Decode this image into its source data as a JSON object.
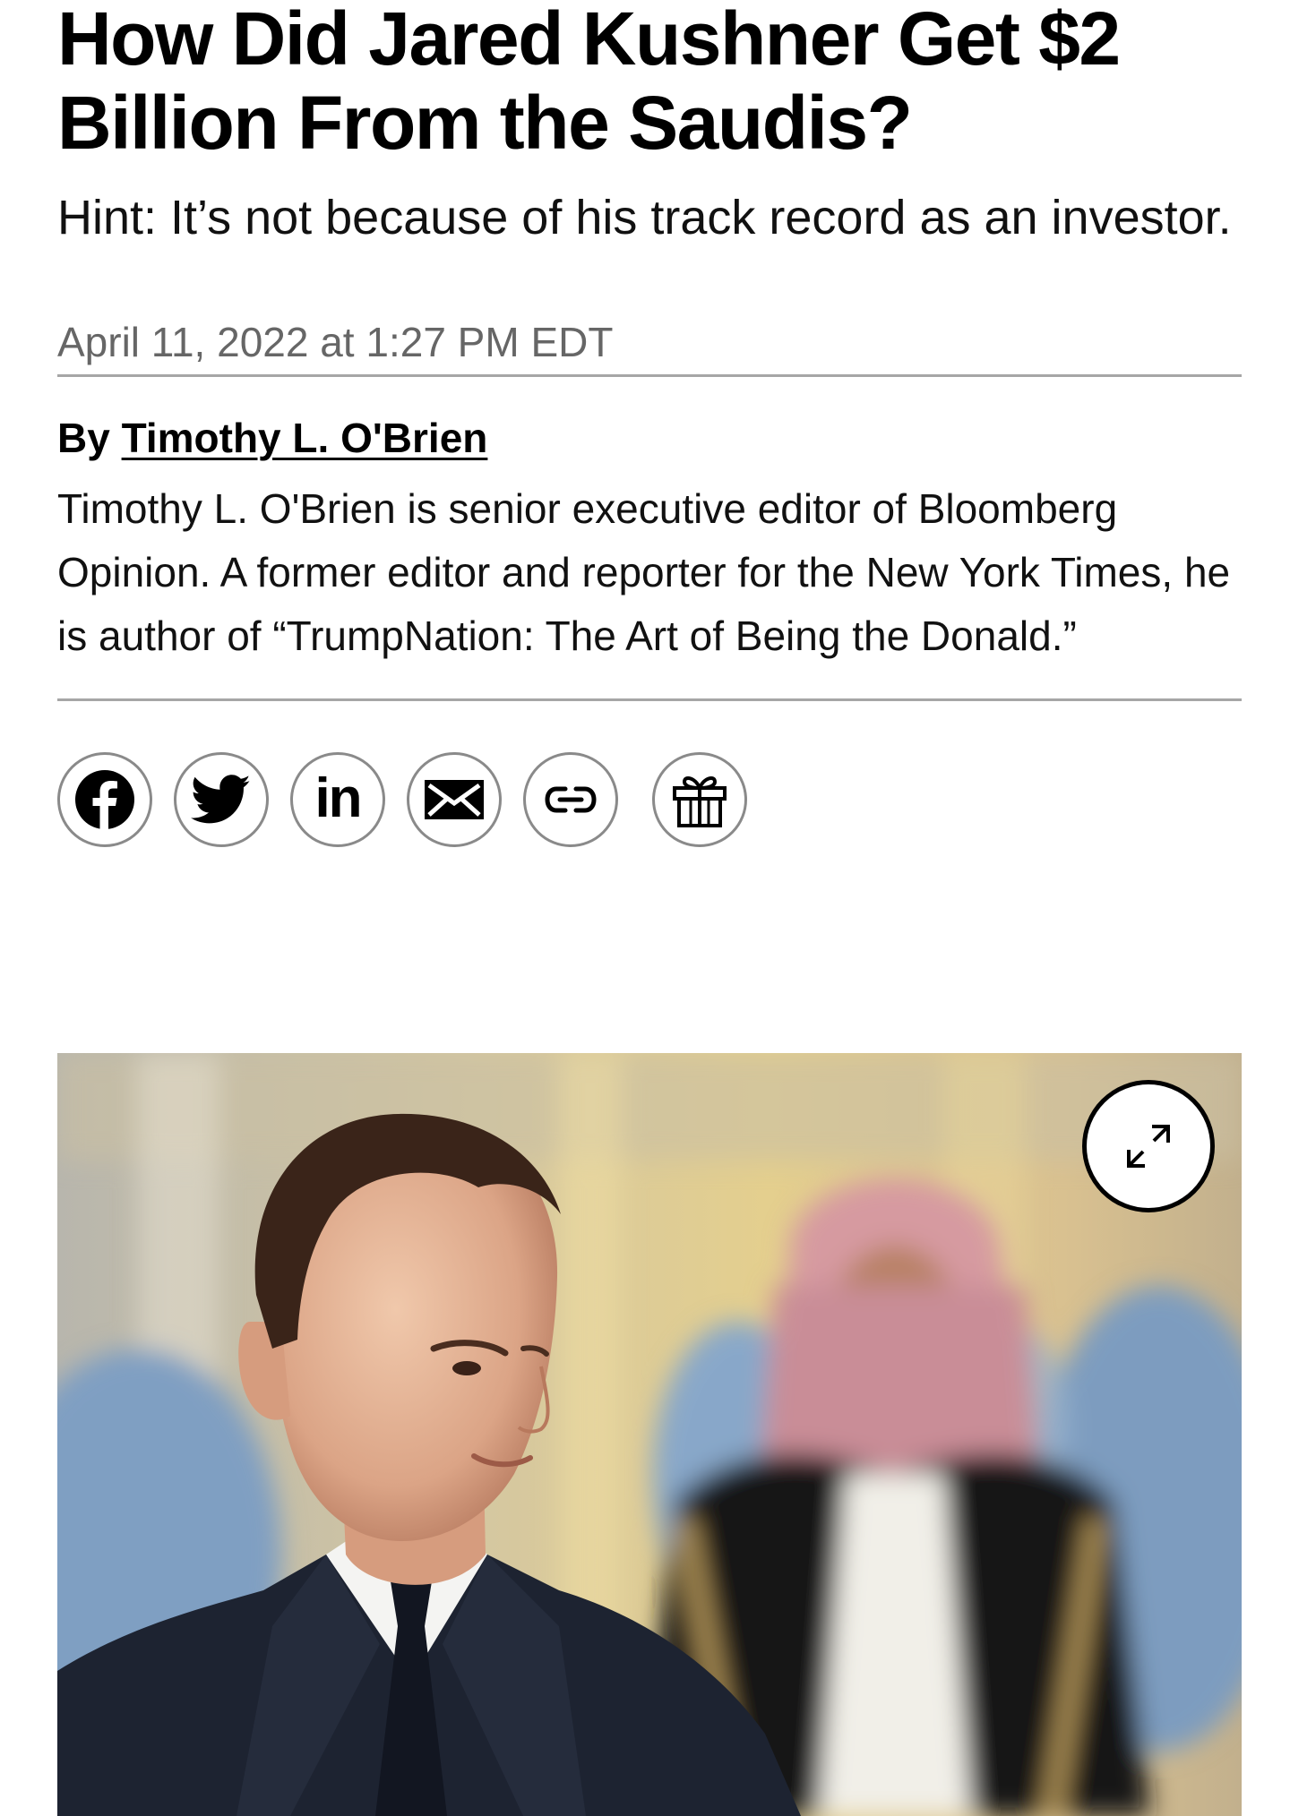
{
  "article": {
    "headline": "How Did Jared Kushner Get $2 Billion From the Saudis?",
    "dek": "Hint: It’s not because of his track record as an investor.",
    "timestamp": "April 11, 2022 at 1:27 PM EDT",
    "byline_prefix": "By",
    "author": "Timothy L. O'Brien",
    "bio": "Timothy L. O'Brien is senior executive editor of Bloomberg Opinion. A former editor and reporter for the New York Times, he is author of “TrumpNation: The Art of Being the Donald.”"
  },
  "share": {
    "buttons": [
      {
        "icon": "facebook-icon"
      },
      {
        "icon": "twitter-icon"
      },
      {
        "icon": "linkedin-icon",
        "text": "in"
      },
      {
        "icon": "email-icon"
      },
      {
        "icon": "link-icon"
      },
      {
        "icon": "gift-icon"
      }
    ]
  },
  "hero": {
    "expand_icon": "expand-icon"
  }
}
